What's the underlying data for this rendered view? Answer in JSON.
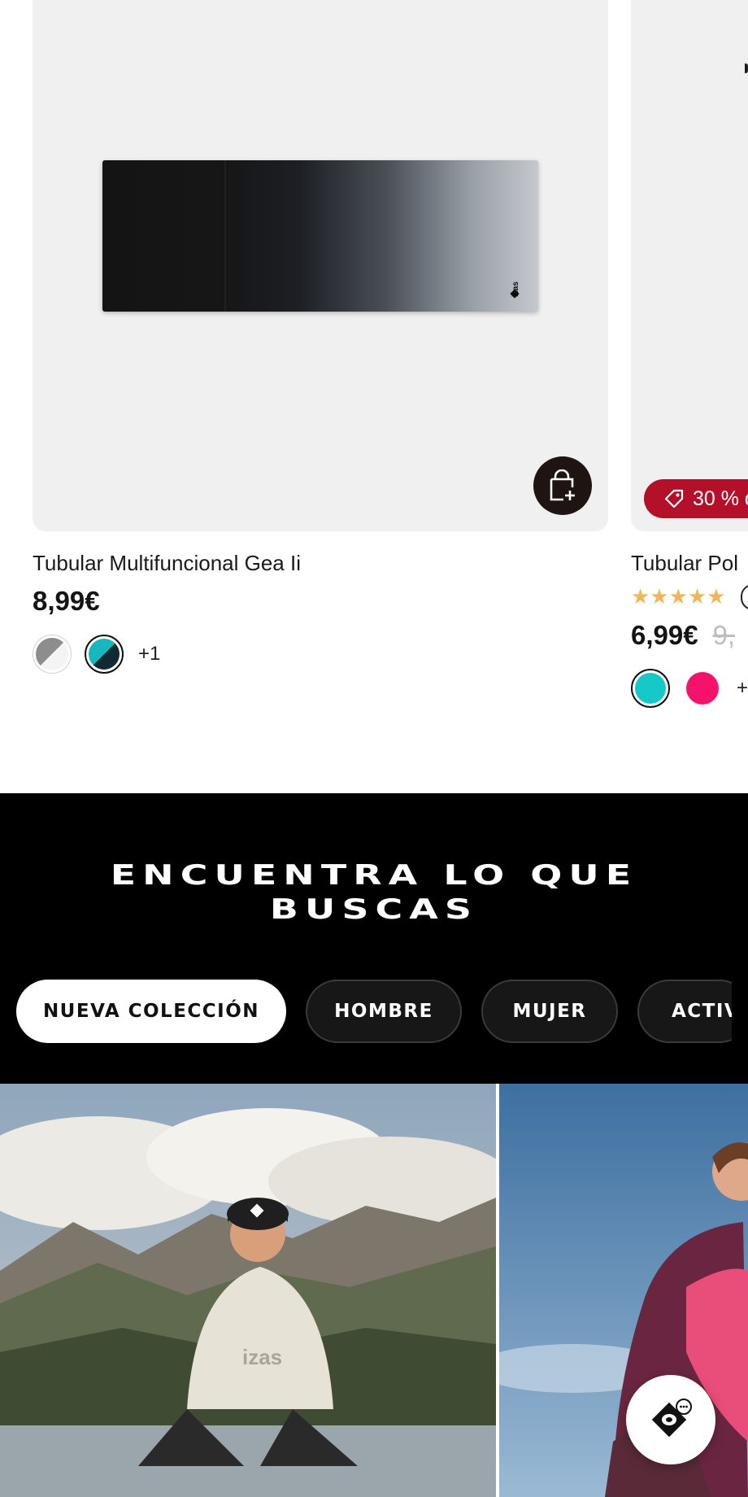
{
  "products": [
    {
      "name": "Tubular Multifuncional Gea Ii",
      "price": "8,99€",
      "more_colors": "+1",
      "swatches": [
        {
          "name": "grey-white",
          "colors": [
            "#9a9a9a",
            "#ffffff"
          ],
          "selected": false
        },
        {
          "name": "teal-black",
          "colors": [
            "#16b8bd",
            "#0f2a33"
          ],
          "selected": true
        }
      ],
      "image_icon": "towel-product-image",
      "cart_icon": "add-to-bag-icon"
    },
    {
      "name": "Tubular Pol",
      "price": "6,99€",
      "old_price": "9,",
      "rating_stars": "★★★★★",
      "rating": 5,
      "badge": "30 % d",
      "more_colors": "+",
      "swatches": [
        {
          "name": "turquoise",
          "color": "#16c8c8",
          "selected": true
        },
        {
          "name": "magenta",
          "color": "#f5126c",
          "selected": false
        }
      ],
      "badge_icon": "tag-icon"
    }
  ],
  "finder": {
    "title_line1": "ENCUENTRA LO QUE",
    "title_line2": "BUSCAS",
    "pills": [
      {
        "label": "NUEVA COLECCIÓN",
        "active": true
      },
      {
        "label": "HOMBRE",
        "active": false
      },
      {
        "label": "MUJER",
        "active": false
      },
      {
        "label": "ACTIV",
        "active": false
      }
    ]
  },
  "photos": [
    {
      "subject": "man-in-hoodie-mountains",
      "hoodie_text": "izas"
    },
    {
      "subject": "woman-pink-jacket-sky"
    }
  ],
  "chat_fab": {
    "icon": "izas-chat-icon"
  },
  "colors": {
    "accent_dark": "#1e1513",
    "badge_red": "#b5102a",
    "star": "#f0b75a",
    "finder_bg": "#000000"
  }
}
